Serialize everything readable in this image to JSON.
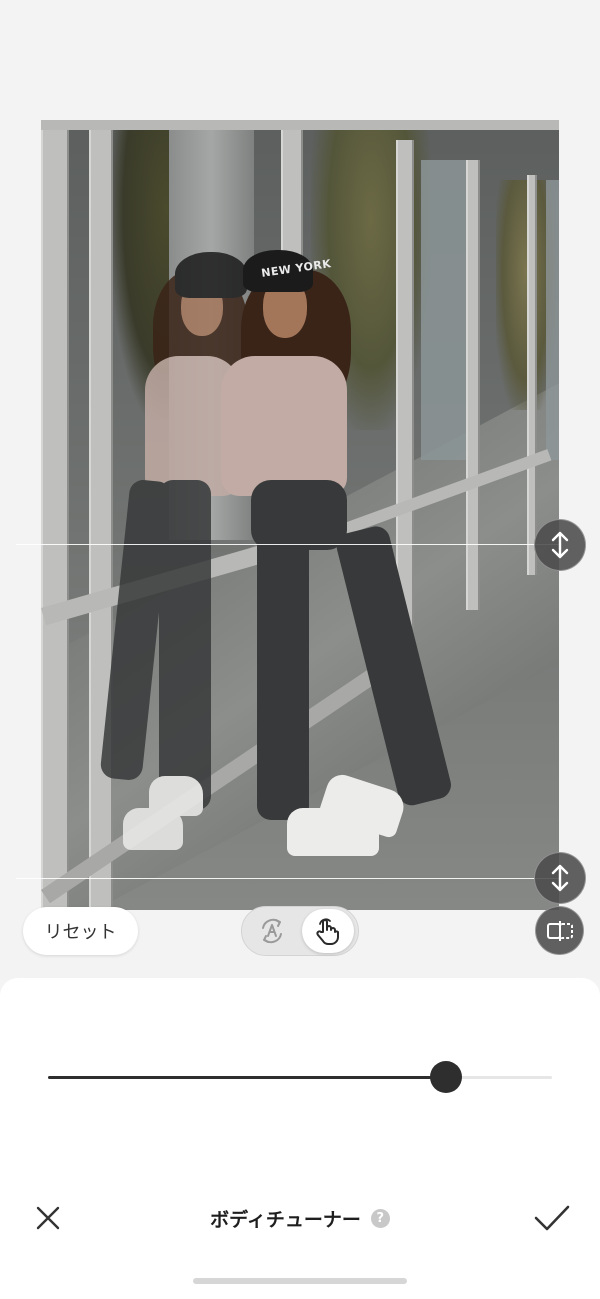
{
  "photo": {
    "subject": "woman-leaning-on-glass-wall",
    "beanie_text": "NEW YORK"
  },
  "guides": {
    "top_handle_icon": "vertical-resize-icon",
    "bottom_handle_icon": "vertical-resize-icon"
  },
  "controls": {
    "reset_label": "リセット",
    "mode_auto_icon": "auto-body-icon",
    "mode_manual_icon": "hand-touch-icon",
    "active_mode": "manual",
    "compare_icon": "compare-icon"
  },
  "slider": {
    "value_fraction": 0.79
  },
  "toolbar": {
    "title": "ボディチューナー",
    "help_label": "?",
    "cancel_icon": "close-icon",
    "apply_icon": "checkmark-icon"
  },
  "colors": {
    "background": "#f3f3f3",
    "panel": "#ffffff",
    "accent_dark": "#2e2e2e",
    "handle": "#4b4b4b"
  }
}
